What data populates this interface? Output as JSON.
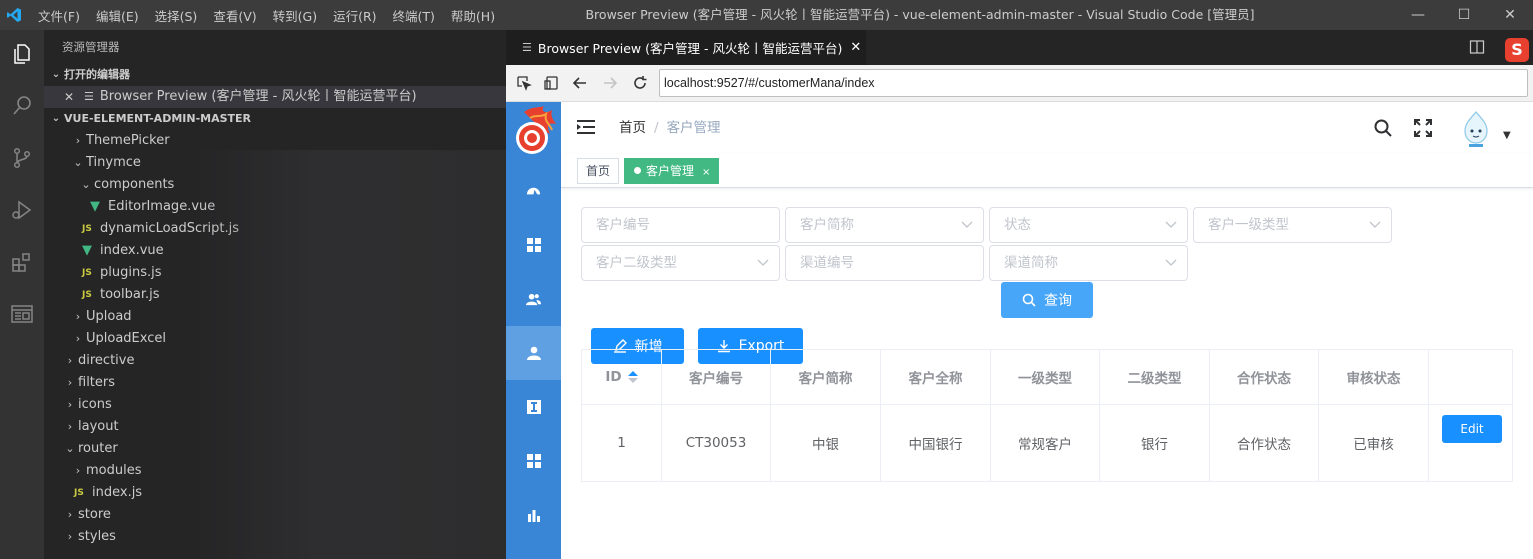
{
  "titlebar": {
    "menus": [
      "文件(F)",
      "编辑(E)",
      "选择(S)",
      "查看(V)",
      "转到(G)",
      "运行(R)",
      "终端(T)",
      "帮助(H)"
    ],
    "window_title": "Browser Preview (客户管理 - 风火轮丨智能运营平台) - vue-element-admin-master - Visual Studio Code [管理员]",
    "minimize": "—",
    "maximize": "☐",
    "close": "✕"
  },
  "sidebar": {
    "title": "资源管理器",
    "open_editors_label": "打开的编辑器",
    "open_editor_item": "Browser Preview (客户管理 - 风火轮丨智能运营平台)",
    "project_label": "VUE-ELEMENT-ADMIN-MASTER",
    "tree": [
      {
        "label": "ThemePicker",
        "indent": 2,
        "kind": "folder",
        "open": false
      },
      {
        "label": "Tinymce",
        "indent": 2,
        "kind": "folder",
        "open": true
      },
      {
        "label": "components",
        "indent": 3,
        "kind": "folder",
        "open": true
      },
      {
        "label": "EditorImage.vue",
        "indent": 4,
        "kind": "vue"
      },
      {
        "label": "dynamicLoadScript.js",
        "indent": 3,
        "kind": "js"
      },
      {
        "label": "index.vue",
        "indent": 3,
        "kind": "vue"
      },
      {
        "label": "plugins.js",
        "indent": 3,
        "kind": "js"
      },
      {
        "label": "toolbar.js",
        "indent": 3,
        "kind": "js"
      },
      {
        "label": "Upload",
        "indent": 2,
        "kind": "folder",
        "open": false
      },
      {
        "label": "UploadExcel",
        "indent": 2,
        "kind": "folder",
        "open": false
      },
      {
        "label": "directive",
        "indent": 1,
        "kind": "folder",
        "open": false
      },
      {
        "label": "filters",
        "indent": 1,
        "kind": "folder",
        "open": false
      },
      {
        "label": "icons",
        "indent": 1,
        "kind": "folder",
        "open": false
      },
      {
        "label": "layout",
        "indent": 1,
        "kind": "folder",
        "open": false
      },
      {
        "label": "router",
        "indent": 1,
        "kind": "folder",
        "open": true
      },
      {
        "label": "modules",
        "indent": 2,
        "kind": "folder",
        "open": false
      },
      {
        "label": "index.js",
        "indent": 2,
        "kind": "js"
      },
      {
        "label": "store",
        "indent": 1,
        "kind": "folder",
        "open": false
      },
      {
        "label": "styles",
        "indent": 1,
        "kind": "folder",
        "open": false
      }
    ]
  },
  "editor": {
    "tab_label": "Browser Preview (客户管理 - 风火轮丨智能运营平台)",
    "sogou_label": "S"
  },
  "browser": {
    "url": "localhost:9527/#/customerMana/index"
  },
  "app": {
    "breadcrumb": {
      "home": "首页",
      "separator": "/",
      "current": "客户管理"
    },
    "tags": {
      "home": "首页",
      "active": "客户管理",
      "close": "×"
    },
    "filters": {
      "customer_code": "客户编号",
      "customer_short": "客户简称",
      "status": "状态",
      "type1": "客户一级类型",
      "type2": "客户二级类型",
      "channel_code": "渠道编号",
      "channel_short": "渠道简称"
    },
    "buttons": {
      "search": "查询",
      "add": "新增",
      "export": "Export"
    },
    "table": {
      "headers": [
        "ID",
        "客户编号",
        "客户简称",
        "客户全称",
        "一级类型",
        "二级类型",
        "合作状态",
        "审核状态",
        ""
      ],
      "rows": [
        [
          "1",
          "CT30053",
          "中银",
          "中国银行",
          "常规客户",
          "银行",
          "合作状态",
          "已审核",
          "Edit"
        ]
      ]
    }
  },
  "colors": {
    "vscode_titlebar": "#3c3c3c",
    "vscode_sidebar": "#252526",
    "app_sidebar": "#3a86d6",
    "primary": "#1890ff",
    "tag_active": "#42b983"
  }
}
